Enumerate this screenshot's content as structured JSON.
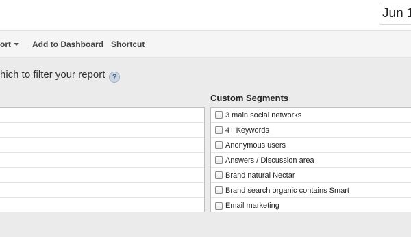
{
  "header": {
    "date_range": "Jun 1"
  },
  "toolbar": {
    "export_label": "ort",
    "add_to_dashboard_label": "Add to Dashboard",
    "shortcut_label": "Shortcut"
  },
  "segments_panel": {
    "instruction": "hich to filter your report",
    "help_icon_glyph": "?",
    "custom_segments_header": "Custom Segments",
    "custom_segments": [
      {
        "label": "3 main social networks",
        "checked": false
      },
      {
        "label": "4+ Keywords",
        "checked": false
      },
      {
        "label": "Anonymous users",
        "checked": false
      },
      {
        "label": "Answers / Discussion area",
        "checked": false
      },
      {
        "label": "Brand natural Nectar",
        "checked": false
      },
      {
        "label": "Brand search organic contains Smart",
        "checked": false
      },
      {
        "label": "Email marketing",
        "checked": false
      }
    ]
  }
}
